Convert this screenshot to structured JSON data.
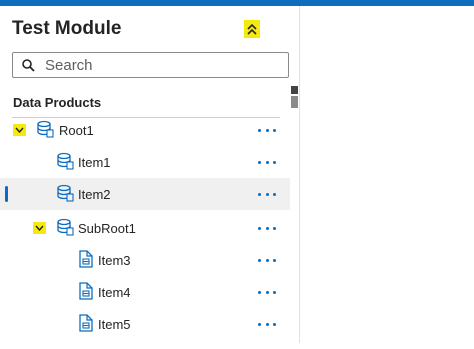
{
  "header": {
    "title": "Test Module"
  },
  "search": {
    "placeholder": "Search"
  },
  "section": {
    "label": "Data Products"
  },
  "colors": {
    "accent": "#0f6cbd",
    "highlight": "#f5e90f",
    "selected_bg": "#f0f0f0"
  },
  "tree": [
    {
      "label": "Root1",
      "icon": "database-icon",
      "expanded": true
    },
    {
      "label": "Item1",
      "icon": "database-icon"
    },
    {
      "label": "Item2",
      "icon": "database-icon",
      "selected": true
    },
    {
      "label": "SubRoot1",
      "icon": "database-icon",
      "expanded": true
    },
    {
      "label": "Item3",
      "icon": "document-icon"
    },
    {
      "label": "Item4",
      "icon": "document-icon"
    },
    {
      "label": "Item5",
      "icon": "document-icon"
    }
  ]
}
